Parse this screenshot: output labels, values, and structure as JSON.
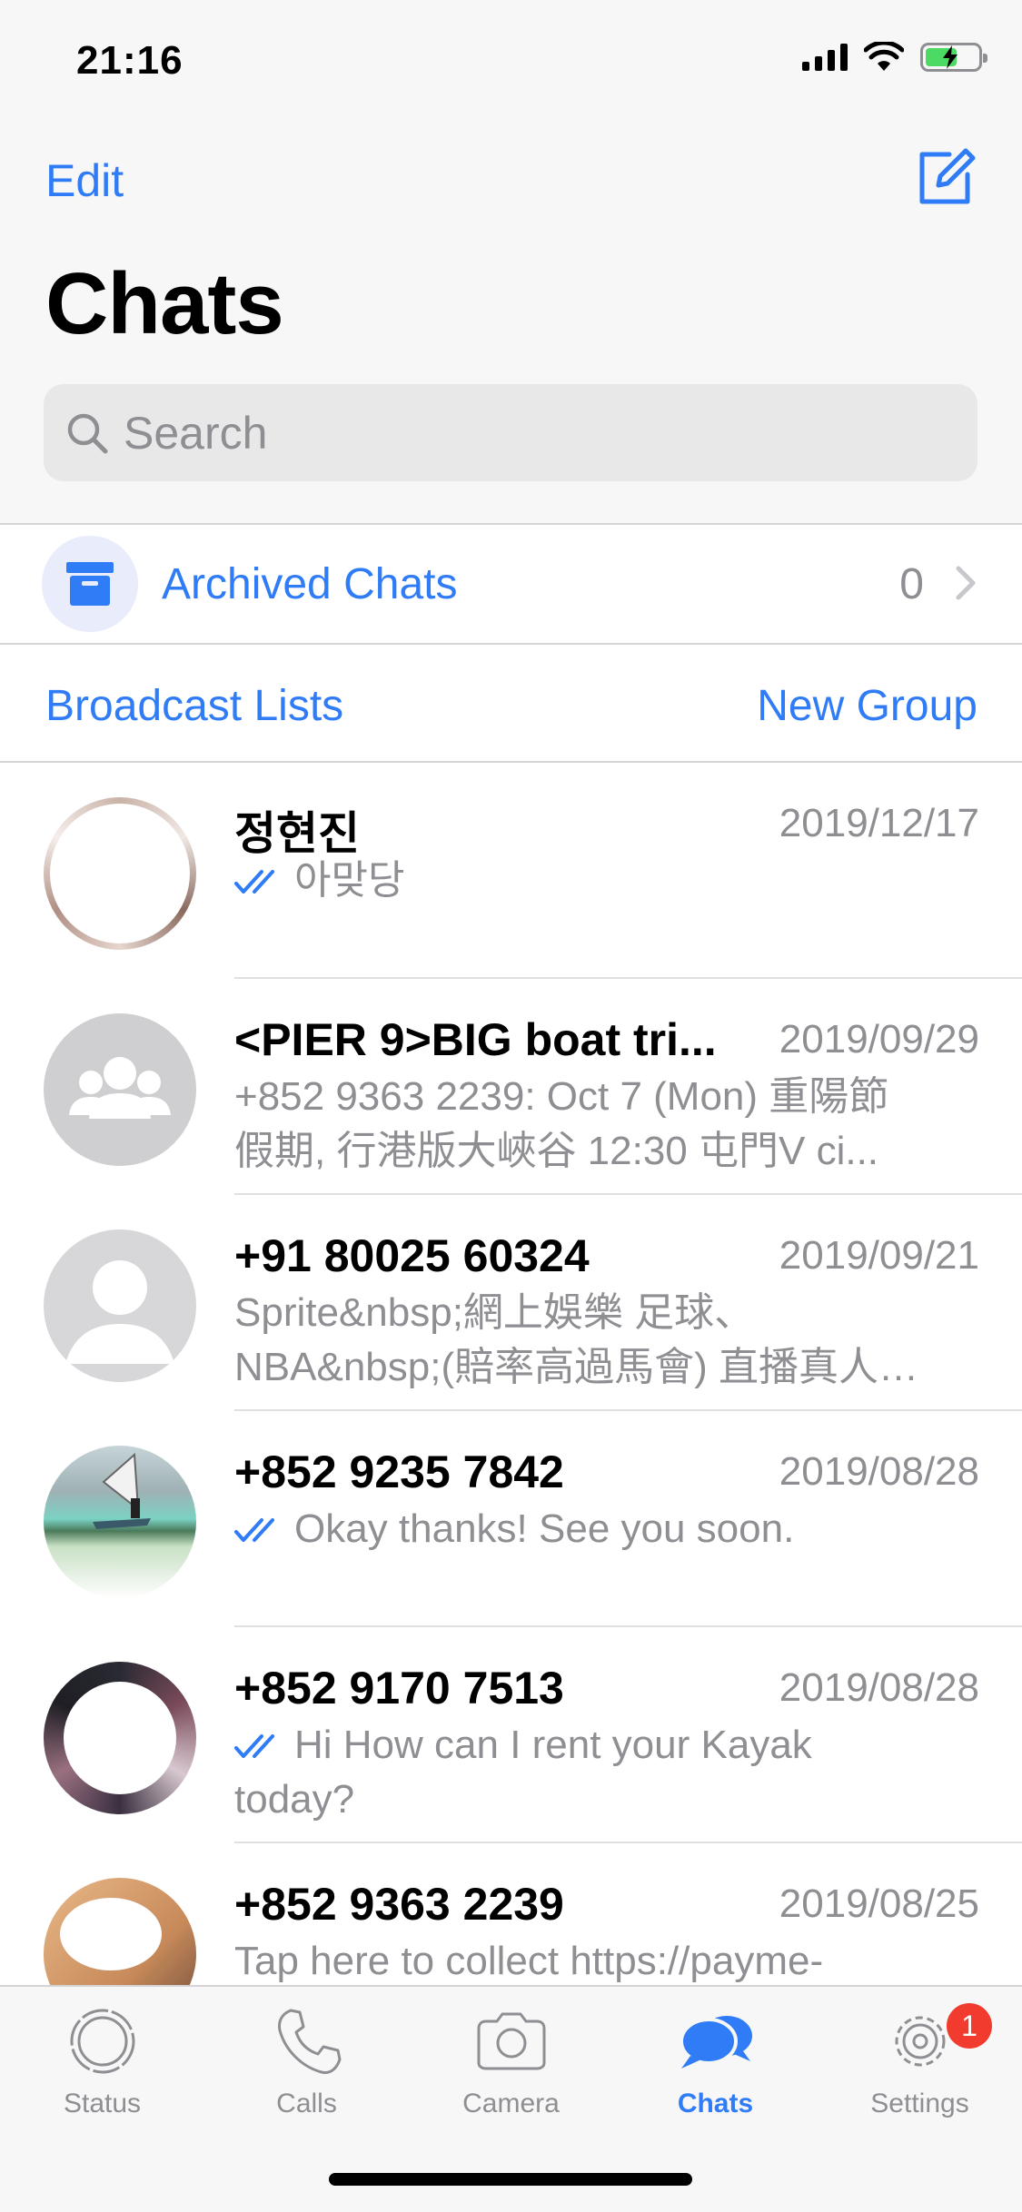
{
  "status_bar": {
    "time": "21:16",
    "battery_percent": 60
  },
  "nav": {
    "edit_label": "Edit",
    "title": "Chats"
  },
  "search": {
    "placeholder": "Search"
  },
  "archived": {
    "label": "Archived Chats",
    "count": "0"
  },
  "links": {
    "broadcast": "Broadcast Lists",
    "new_group": "New Group"
  },
  "chats": [
    {
      "name": "정현진",
      "date": "2019/12/17",
      "preview": "아맞당",
      "read_ticks": true,
      "avatar": "photo-ring"
    },
    {
      "name": "<PIER 9>BIG boat tri...",
      "date": "2019/09/29",
      "preview": "+852 9363 2239: Oct 7 (Mon) 重陽節假期, 行港版大峽谷 12:30 屯門V ci...",
      "read_ticks": false,
      "avatar": "group-placeholder"
    },
    {
      "name": "+91 80025 60324",
      "date": "2019/09/21",
      "preview": "Sprite&nbsp;網上娛樂 足球、NBA&nbsp;(賠率高過馬會) 直播真人…",
      "read_ticks": false,
      "avatar": "person-placeholder"
    },
    {
      "name": "+852 9235 7842",
      "date": "2019/08/28",
      "preview": "Okay thanks! See you soon.",
      "read_ticks": true,
      "avatar": "windsurf-photo"
    },
    {
      "name": "+852 9170 7513",
      "date": "2019/08/28",
      "preview": "Hi How can I rent your Kayak today?",
      "read_ticks": true,
      "avatar": "photo-dark"
    },
    {
      "name": "+852 9363 2239",
      "date": "2019/08/25",
      "preview": "Tap here to collect https://payme-",
      "read_ticks": false,
      "avatar": "photo-face"
    }
  ],
  "tabs": [
    {
      "label": "Status",
      "icon": "status-icon"
    },
    {
      "label": "Calls",
      "icon": "phone-icon"
    },
    {
      "label": "Camera",
      "icon": "camera-icon"
    },
    {
      "label": "Chats",
      "icon": "chats-icon",
      "active": true
    },
    {
      "label": "Settings",
      "icon": "gear-icon",
      "badge": "1"
    }
  ],
  "colors": {
    "accent": "#2f7cf6",
    "badge": "#f23b2f",
    "muted": "#8e8e93"
  }
}
